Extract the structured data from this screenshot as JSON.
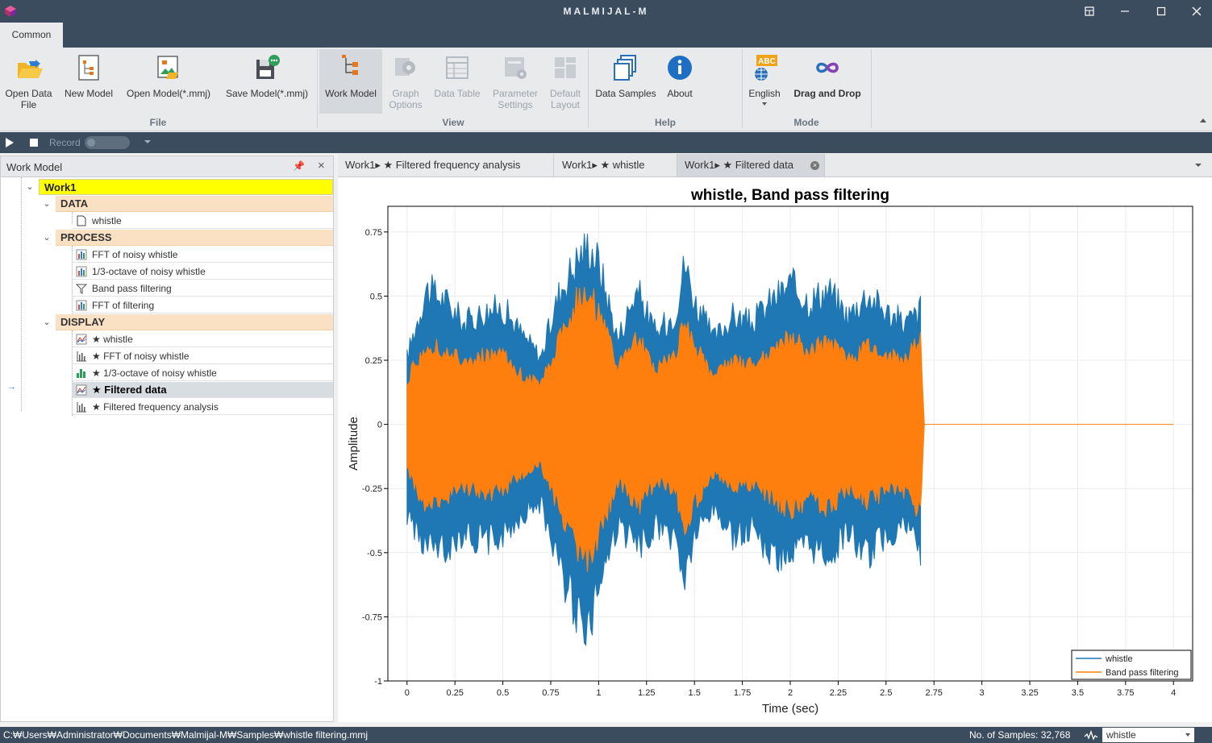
{
  "window": {
    "title": "MALMIJAL-M",
    "controls": [
      "restore-down",
      "minimize",
      "maximize",
      "close"
    ]
  },
  "ribbon": {
    "tab": "Common",
    "groups": {
      "file": "File",
      "view": "View",
      "help": "Help",
      "mode": "Mode"
    },
    "buttons": {
      "open_data_file": "Open Data\nFile",
      "new_model": "New Model",
      "open_model": "Open Model(*.mmj)",
      "save_model": "Save Model(*.mmj)",
      "work_model": "Work Model",
      "graph_options": "Graph\nOptions",
      "data_table": "Data Table",
      "parameter_settings": "Parameter\nSettings",
      "default_layout": "Default\nLayout",
      "data_samples": "Data Samples",
      "about": "About",
      "english": "English",
      "drag_and_drop": "Drag and Drop"
    },
    "english_badge": "ABC"
  },
  "record_bar": {
    "record_label": "Record",
    "record_on": false
  },
  "work_model": {
    "title": "Work Model",
    "root": "Work1",
    "groups": {
      "data": "DATA",
      "process": "PROCESS",
      "display": "DISPLAY"
    },
    "data_items": [
      "whistle"
    ],
    "process_items": [
      "FFT of noisy whistle",
      "1/3-octave of noisy whistle",
      "Band pass filtering",
      "FFT of filtering"
    ],
    "display_items": [
      "★ whistle",
      "★ FFT of noisy whistle",
      "★ 1/3-octave of noisy whistle",
      "★ Filtered data",
      "★ Filtered frequency analysis"
    ],
    "selected_display_index": 3
  },
  "doc_tabs": [
    {
      "label": "Work1▸ ★ Filtered frequency analysis",
      "active": false
    },
    {
      "label": "Work1▸ ★ whistle",
      "active": false
    },
    {
      "label": "Work1▸ ★ Filtered data",
      "active": true
    }
  ],
  "colors": {
    "whistle": "#1f77b4",
    "band_pass": "#ff7f0e",
    "title_bar": "#3c4c5f",
    "root_highlight": "#ffff00",
    "group_highlight": "#fbe1c4"
  },
  "chart_data": {
    "type": "line",
    "title": "whistle, Band pass filtering",
    "xlabel": "Time (sec)",
    "ylabel": "Amplitude",
    "xlim": [
      -0.1,
      4.1
    ],
    "ylim": [
      -1,
      0.85
    ],
    "x_ticks": [
      "0",
      "0.25",
      "0.5",
      "0.75",
      "1",
      "1.25",
      "1.5",
      "1.75",
      "2",
      "2.25",
      "2.5",
      "2.75",
      "3",
      "3.25",
      "3.5",
      "3.75",
      "4"
    ],
    "y_ticks": [
      "0.75",
      "0.5",
      "0.25",
      "0",
      "-0.25",
      "-0.5",
      "-0.75",
      "-1"
    ],
    "y_tick_values": [
      0.75,
      0.5,
      0.25,
      0,
      -0.25,
      -0.5,
      -0.75,
      -1
    ],
    "x_tick_values": [
      0,
      0.25,
      0.5,
      0.75,
      1,
      1.25,
      1.5,
      1.75,
      2,
      2.25,
      2.5,
      2.75,
      3,
      3.25,
      3.5,
      3.75,
      4
    ],
    "grid": true,
    "legend_position": "bottom-right",
    "series": [
      {
        "name": "whistle",
        "x": [
          0.0,
          0.1,
          0.2,
          0.3,
          0.4,
          0.5,
          0.6,
          0.7,
          0.8,
          0.9,
          0.95,
          1.0,
          1.1,
          1.2,
          1.3,
          1.4,
          1.45,
          1.5,
          1.6,
          1.7,
          1.8,
          1.9,
          2.0,
          2.1,
          2.2,
          2.3,
          2.4,
          2.5,
          2.6,
          2.68
        ],
        "upper": [
          0.3,
          0.6,
          0.55,
          0.45,
          0.5,
          0.52,
          0.4,
          0.3,
          0.6,
          0.75,
          0.8,
          0.72,
          0.38,
          0.6,
          0.4,
          0.5,
          0.72,
          0.55,
          0.38,
          0.48,
          0.45,
          0.55,
          0.62,
          0.55,
          0.6,
          0.48,
          0.58,
          0.5,
          0.45,
          0.5
        ],
        "lower": [
          -0.4,
          -0.55,
          -0.55,
          -0.48,
          -0.52,
          -0.5,
          -0.4,
          -0.35,
          -0.65,
          -0.85,
          -0.9,
          -0.72,
          -0.45,
          -0.55,
          -0.45,
          -0.52,
          -0.7,
          -0.5,
          -0.38,
          -0.5,
          -0.45,
          -0.58,
          -0.58,
          -0.55,
          -0.58,
          -0.48,
          -0.58,
          -0.5,
          -0.45,
          -0.55
        ]
      },
      {
        "name": "Band pass filtering",
        "x": [
          0.0,
          0.1,
          0.2,
          0.3,
          0.4,
          0.5,
          0.6,
          0.7,
          0.8,
          0.9,
          0.95,
          1.0,
          1.1,
          1.2,
          1.3,
          1.4,
          1.45,
          1.5,
          1.6,
          1.7,
          1.8,
          1.9,
          2.0,
          2.1,
          2.2,
          2.3,
          2.4,
          2.5,
          2.6,
          2.68,
          2.7,
          4.0
        ],
        "upper": [
          0.2,
          0.35,
          0.32,
          0.28,
          0.3,
          0.3,
          0.22,
          0.18,
          0.4,
          0.58,
          0.6,
          0.5,
          0.25,
          0.38,
          0.25,
          0.3,
          0.45,
          0.35,
          0.22,
          0.28,
          0.26,
          0.32,
          0.4,
          0.32,
          0.38,
          0.28,
          0.34,
          0.3,
          0.3,
          0.4,
          0,
          0
        ],
        "lower": [
          -0.22,
          -0.35,
          -0.32,
          -0.28,
          -0.3,
          -0.3,
          -0.22,
          -0.18,
          -0.4,
          -0.58,
          -0.62,
          -0.5,
          -0.25,
          -0.38,
          -0.25,
          -0.3,
          -0.45,
          -0.35,
          -0.22,
          -0.28,
          -0.26,
          -0.32,
          -0.4,
          -0.32,
          -0.38,
          -0.28,
          -0.34,
          -0.3,
          -0.3,
          -0.4,
          0,
          0
        ]
      }
    ]
  },
  "status_bar": {
    "path": "C:₩Users₩Administrator₩Documents₩Malmijal-M₩Samples₩whistle filtering.mmj",
    "samples": "No. of Samples: 32,768",
    "selected_signal": "whistle"
  }
}
